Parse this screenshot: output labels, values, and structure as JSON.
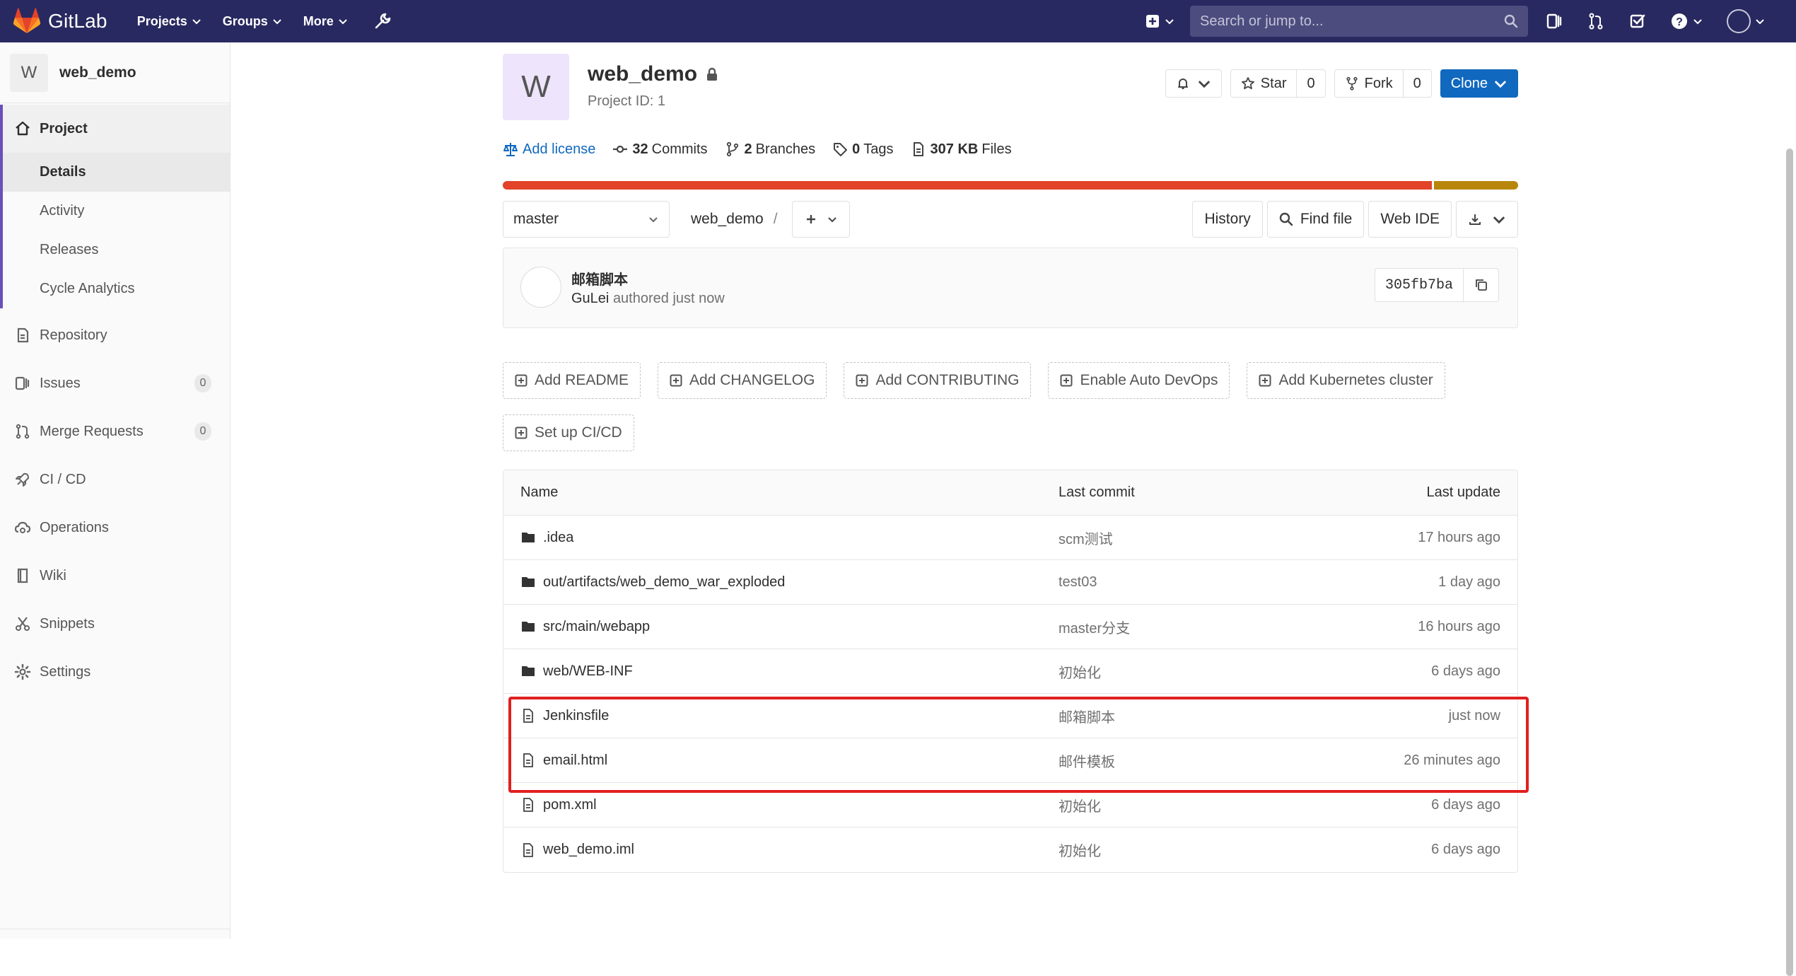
{
  "navbar": {
    "brand": "GitLab",
    "links": [
      "Projects",
      "Groups",
      "More"
    ],
    "search_placeholder": "Search or jump to..."
  },
  "sidebar": {
    "project_initial": "W",
    "project_name": "web_demo",
    "project_label": "Project",
    "sub_items": [
      "Details",
      "Activity",
      "Releases",
      "Cycle Analytics"
    ],
    "items": [
      {
        "label": "Repository"
      },
      {
        "label": "Issues",
        "count": "0"
      },
      {
        "label": "Merge Requests",
        "count": "0"
      },
      {
        "label": "CI / CD"
      },
      {
        "label": "Operations"
      },
      {
        "label": "Wiki"
      },
      {
        "label": "Snippets"
      },
      {
        "label": "Settings"
      }
    ]
  },
  "project": {
    "initial": "W",
    "name": "web_demo",
    "id_text": "Project ID: 1",
    "star_label": "Star",
    "star_count": "0",
    "fork_label": "Fork",
    "fork_count": "0",
    "clone_label": "Clone"
  },
  "stats": {
    "add_license": "Add license",
    "commits_num": "32",
    "commits_label": "Commits",
    "branches_num": "2",
    "branches_label": "Branches",
    "tags_num": "0",
    "tags_label": "Tags",
    "files_size": "307 KB",
    "files_label": "Files"
  },
  "languages": [
    {
      "share": 0.915,
      "color": "#e24329"
    },
    {
      "share": 0.085,
      "color": "#b8860b"
    }
  ],
  "tree_controls": {
    "branch": "master",
    "path": "web_demo",
    "separator": "/",
    "history": "History",
    "find_file": "Find file",
    "web_ide": "Web IDE"
  },
  "last_commit": {
    "title": "邮箱脚本",
    "author": "GuLei",
    "meta": "authored just now",
    "sha": "305fb7ba"
  },
  "quick_links": [
    "Add README",
    "Add CHANGELOG",
    "Add CONTRIBUTING",
    "Enable Auto DevOps",
    "Add Kubernetes cluster",
    "Set up CI/CD"
  ],
  "file_table": {
    "headers": {
      "name": "Name",
      "commit": "Last commit",
      "update": "Last update"
    },
    "rows": [
      {
        "type": "folder",
        "name": ".idea",
        "commit": "scm测试",
        "update": "17 hours ago"
      },
      {
        "type": "folder",
        "name": "out/artifacts/web_demo_war_exploded",
        "commit": "test03",
        "update": "1 day ago"
      },
      {
        "type": "folder",
        "name": "src/main/webapp",
        "commit": "master分支",
        "update": "16 hours ago"
      },
      {
        "type": "folder",
        "name": "web/WEB-INF",
        "commit": "初始化",
        "update": "6 days ago"
      },
      {
        "type": "file",
        "name": "Jenkinsfile",
        "commit": "邮箱脚本",
        "update": "just now"
      },
      {
        "type": "file",
        "name": "email.html",
        "commit": "邮件模板",
        "update": "26 minutes ago"
      },
      {
        "type": "file",
        "name": "pom.xml",
        "commit": "初始化",
        "update": "6 days ago"
      },
      {
        "type": "file",
        "name": "web_demo.iml",
        "commit": "初始化",
        "update": "6 days ago"
      }
    ]
  },
  "colors": {
    "navbar": "#292961",
    "accent": "#6b4fbb",
    "link": "#1068bf",
    "highlight": "#e0201f"
  }
}
